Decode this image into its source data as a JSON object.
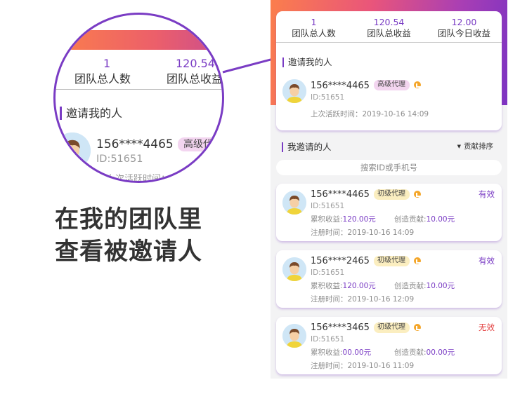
{
  "stats": [
    {
      "value": "1",
      "label": "团队总人数"
    },
    {
      "value": "120.54",
      "label": "团队总收益"
    },
    {
      "value": "12.00",
      "label": "团队今日收益"
    }
  ],
  "inviter": {
    "section_title": "邀请我的人",
    "name": "156****4465",
    "badge": "高级代理",
    "id": "ID:51651",
    "last_active": "上次活跃时间：2019-10-16 14:09"
  },
  "invited": {
    "section_title": "我邀请的人",
    "sort_label": "贡献排序",
    "search_placeholder": "搜索ID或手机号",
    "earnings_label": "累积收益:",
    "contribution_label": "创造贡献:",
    "register_label": "注册时间：",
    "items": [
      {
        "name": "156****4465",
        "badge": "初级代理",
        "id": "ID:51651",
        "status": "有效",
        "earnings": "120.00元",
        "contribution": "10.00元",
        "register_time": "2019-10-16 14:09"
      },
      {
        "name": "156****2465",
        "badge": "初级代理",
        "id": "ID:51651",
        "status": "有效",
        "earnings": "120.00元",
        "contribution": "10.00元",
        "register_time": "2019-10-16 12:09"
      },
      {
        "name": "156****3465",
        "badge": "初级代理",
        "id": "ID:51651",
        "status": "无效",
        "earnings": "00.00元",
        "contribution": "00.00元",
        "register_time": "2019-10-16 11:09"
      }
    ]
  },
  "magnifier": {
    "stat1_value": "1",
    "stat1_label": "团队总人数",
    "stat2_value": "120.54",
    "stat2_label": "团队总收益",
    "section_title": "邀请我的人",
    "name": "156****4465",
    "badge": "高级代",
    "id": "ID:51651",
    "last_active": "上次活跃时间："
  },
  "caption": {
    "line1": "在我的团队里",
    "line2": "查看被邀请人"
  },
  "colors": {
    "accent": "#7a3cc4",
    "valid": "#7a3cc4",
    "invalid": "#e23b3b",
    "gradient_start": "#fb7e4c",
    "gradient_end": "#7d33c2"
  },
  "icons": {
    "avatar": "avatar-icon",
    "crown": "crown-badge-icon",
    "sort": "caret-down-icon"
  }
}
